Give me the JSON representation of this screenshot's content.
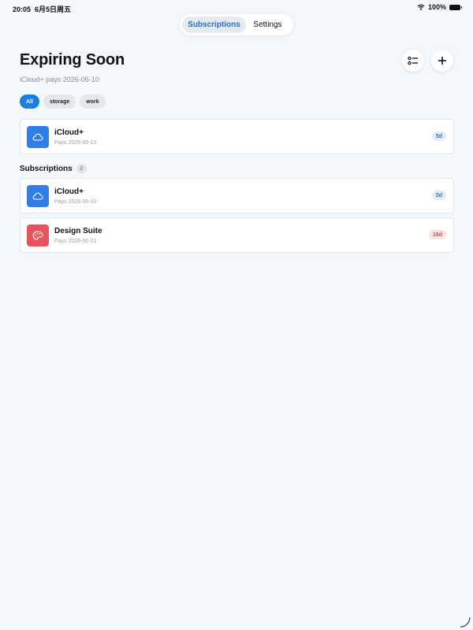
{
  "status_bar": {
    "time": "20:05",
    "date": "6月5日周五",
    "battery": "100%"
  },
  "tabs": [
    {
      "label": "Subscriptions",
      "active": true
    },
    {
      "label": "Settings",
      "active": false
    }
  ],
  "header": {
    "title": "Expiring Soon",
    "subtitle": "iCloud+ pays 2026-06-10"
  },
  "filters": [
    {
      "label": "All",
      "active": true
    },
    {
      "label": "storage",
      "active": false
    },
    {
      "label": "work",
      "active": false
    }
  ],
  "expiring": [
    {
      "name": "iCloud+",
      "pays": "Pays 2026-06-10",
      "badge": "5d",
      "icon": "cloud-icon",
      "color": "#2f7fe6"
    }
  ],
  "subscriptions_section": {
    "title": "Subscriptions",
    "count": "2"
  },
  "subscriptions": [
    {
      "name": "iCloud+",
      "pays": "Pays 2026-06-10",
      "badge": "5d",
      "icon": "cloud-icon",
      "color": "#2f7fe6"
    },
    {
      "name": "Design Suite",
      "pays": "Pays 2026-06-21",
      "badge": "16d",
      "icon": "palette-icon",
      "color": "#e8525a"
    }
  ],
  "colors": {
    "accent": "#1a7ee3",
    "background": "#f3f8fd"
  }
}
